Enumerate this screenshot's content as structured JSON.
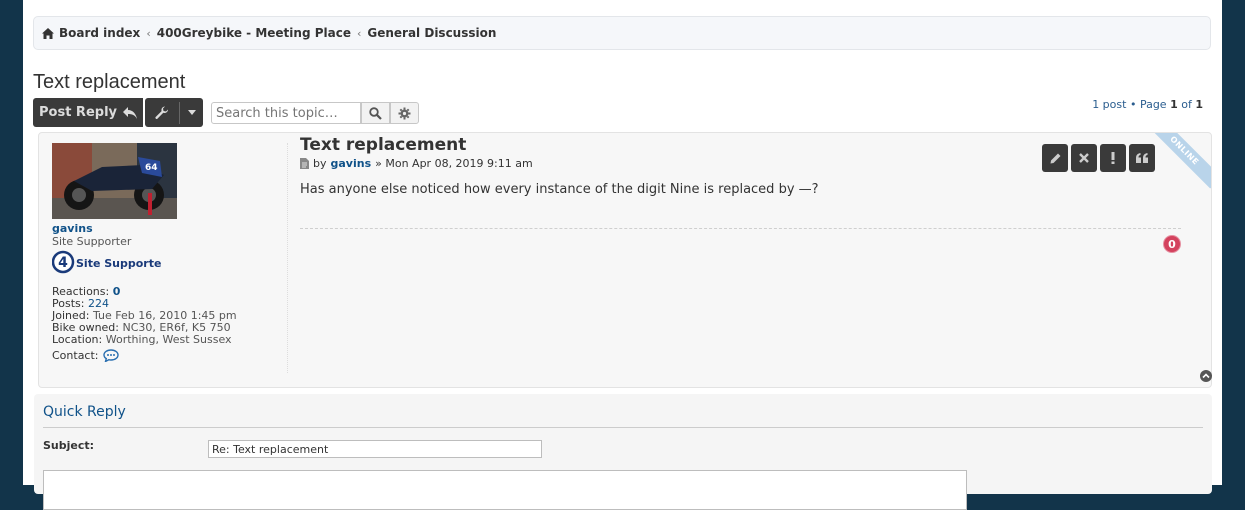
{
  "breadcrumb": [
    {
      "label": "Board index"
    },
    {
      "label": "400Greybike - Meeting Place"
    },
    {
      "label": "General Discussion"
    }
  ],
  "topic": {
    "title": "Text replacement"
  },
  "actions": {
    "post_reply": "Post Reply",
    "search_placeholder": "Search this topic…"
  },
  "pagination": {
    "posts": "1 post",
    "page_word": "Page",
    "current": "1",
    "of_word": "of",
    "total": "1"
  },
  "post": {
    "title": "Text replacement",
    "by": "by",
    "author": "gavins",
    "date": "» Mon Apr 08, 2019 9:11 am",
    "content": "Has anyone else noticed how every instance of the digit Nine is replaced by —?",
    "online_label": "ONLINE",
    "reaction_count": "0"
  },
  "profile": {
    "username": "gavins",
    "rank": "Site Supporter",
    "rank_badge_text": "Site Supporter",
    "rank_badge_number": "4",
    "bike_number": "64",
    "fields": [
      {
        "label": "Reactions:",
        "value": "0",
        "link": true
      },
      {
        "label": "Posts:",
        "value": "224",
        "link": true
      },
      {
        "label": "Joined:",
        "value": "Tue Feb 16, 2010 1:45 pm",
        "link": false
      },
      {
        "label": "Bike owned:",
        "value": "NC30, ER6f, K5 750",
        "link": false
      },
      {
        "label": "Location:",
        "value": "Worthing, West Sussex",
        "link": false
      }
    ],
    "contact_label": "Contact:"
  },
  "quick_reply": {
    "title": "Quick Reply",
    "subject_label": "Subject:",
    "subject_value": "Re: Text replacement"
  },
  "colors": {
    "link": "#105289",
    "button_dark": "#3a3a3a",
    "reaction": "#d4425e",
    "page_bg": "#12344a"
  }
}
